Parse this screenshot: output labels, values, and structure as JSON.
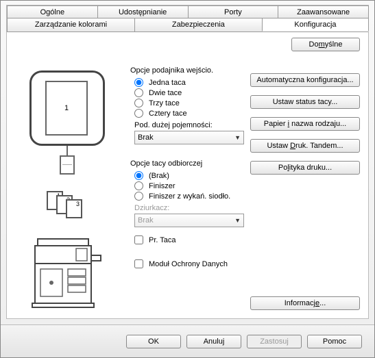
{
  "tabs": {
    "row1": [
      "Ogólne",
      "Udostępnianie",
      "Porty",
      "Zaawansowane"
    ],
    "row2": [
      "Zarządzanie kolorami",
      "Zabezpieczenia",
      "Konfiguracja"
    ],
    "active": "Konfiguracja"
  },
  "buttons": {
    "defaults": "Do<u class='hot'>m</u>yślne",
    "autoconfig": "Automatyczna konfiguracja...",
    "tray_status": "Ustaw status tacy...",
    "paper_name": "Papier <u class='hot'>i</u> nazwa rodzaju...",
    "tandem": "Ustaw <u class='hot'>D</u>ruk. Tandem...",
    "policy": "Po<u class='hot'>l</u>ityka druku...",
    "info": "Informacj<u class='hot'>e</u>...",
    "ok": "OK",
    "cancel": "Anuluj",
    "apply": "Zastosuj",
    "help": "Pomoc"
  },
  "input_trays": {
    "title": "Opcje podajnika wejścio.",
    "options": [
      "Jedna taca",
      "Dwie tace",
      "Trzy tace",
      "Cztery tace"
    ],
    "selected": 0,
    "capacity_label": "Pod. dużej pojemności:",
    "capacity_value": "Brak"
  },
  "output_trays": {
    "title": "Opcje tacy odbiorczej",
    "options": [
      "(Brak)",
      "Finiszer",
      "Finiszer z wykań. siodło."
    ],
    "selected": 0,
    "puncher_label": "Dziurkacz:",
    "puncher_value": "Brak",
    "right_tray": "Pr. Taca"
  },
  "dsk": {
    "label": "Moduł Ochrony Danych"
  },
  "preview": {
    "tray_number": "1"
  }
}
